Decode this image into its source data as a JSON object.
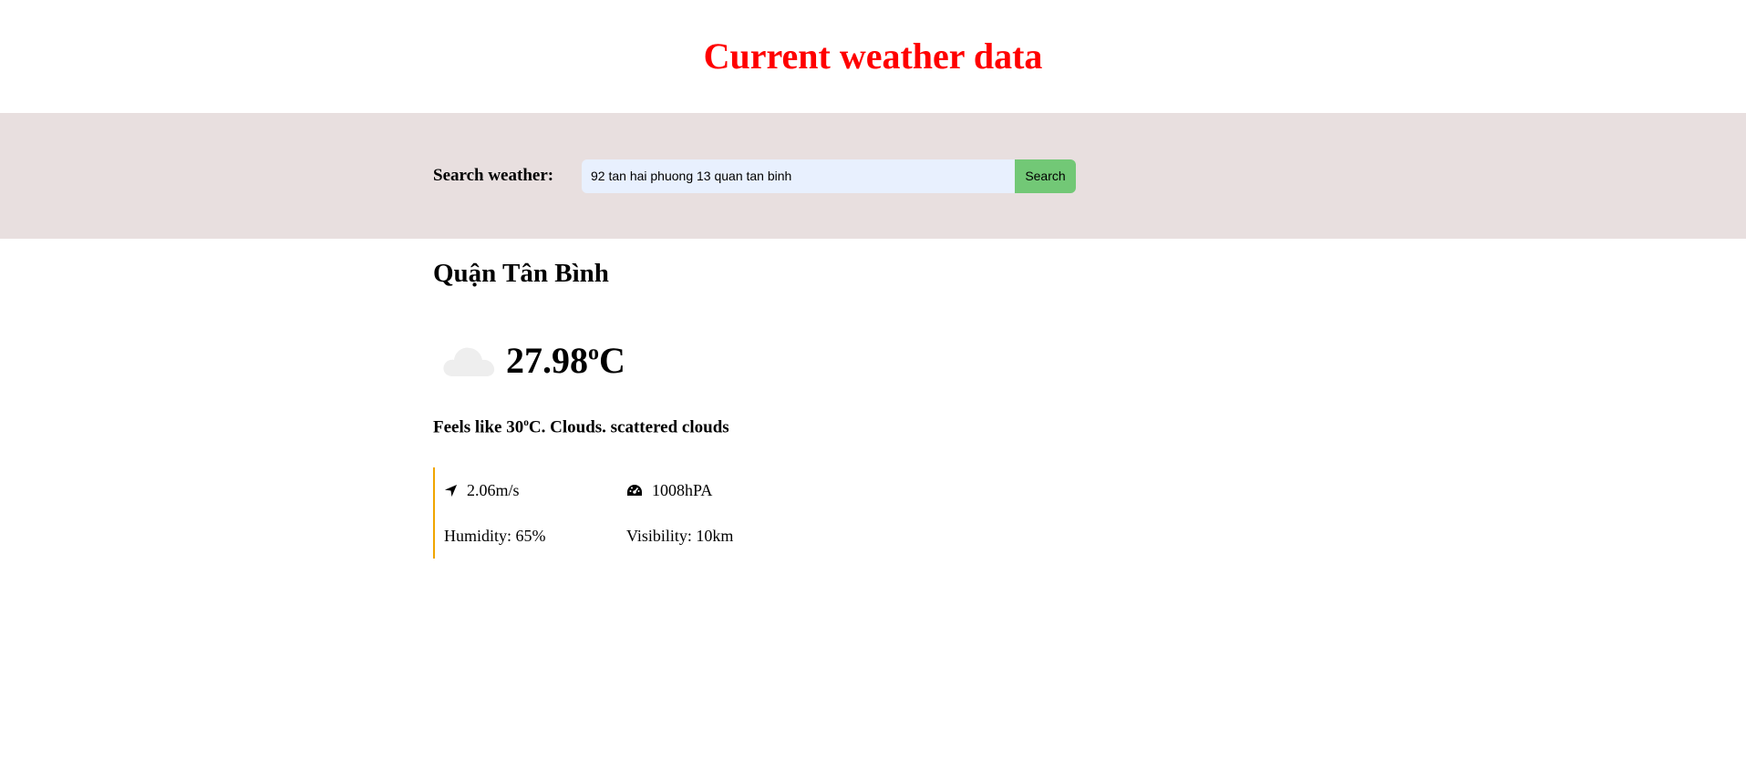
{
  "header": {
    "title": "Current weather data"
  },
  "search": {
    "label": "Search weather:",
    "value": "92 tan hai phuong 13 quan tan binh",
    "button_label": "Search"
  },
  "weather": {
    "city": "Quận Tân Bình",
    "icon": "cloud-icon",
    "temperature_value": "27.98",
    "temperature_degree": "o",
    "temperature_unit": "C",
    "feels_prefix": "Feels like 30",
    "feels_degree": "o",
    "feels_suffix": "C. Clouds. scattered clouds",
    "wind": "2.06m/s",
    "pressure": "1008hPA",
    "humidity": "Humidity: 65%",
    "visibility": "Visibility: 10km"
  },
  "colors": {
    "title": "#ff0000",
    "band": "#e8dfdf",
    "input_bg": "#e8f0fe",
    "button_bg": "#72c876",
    "details_border": "#f0a500"
  }
}
